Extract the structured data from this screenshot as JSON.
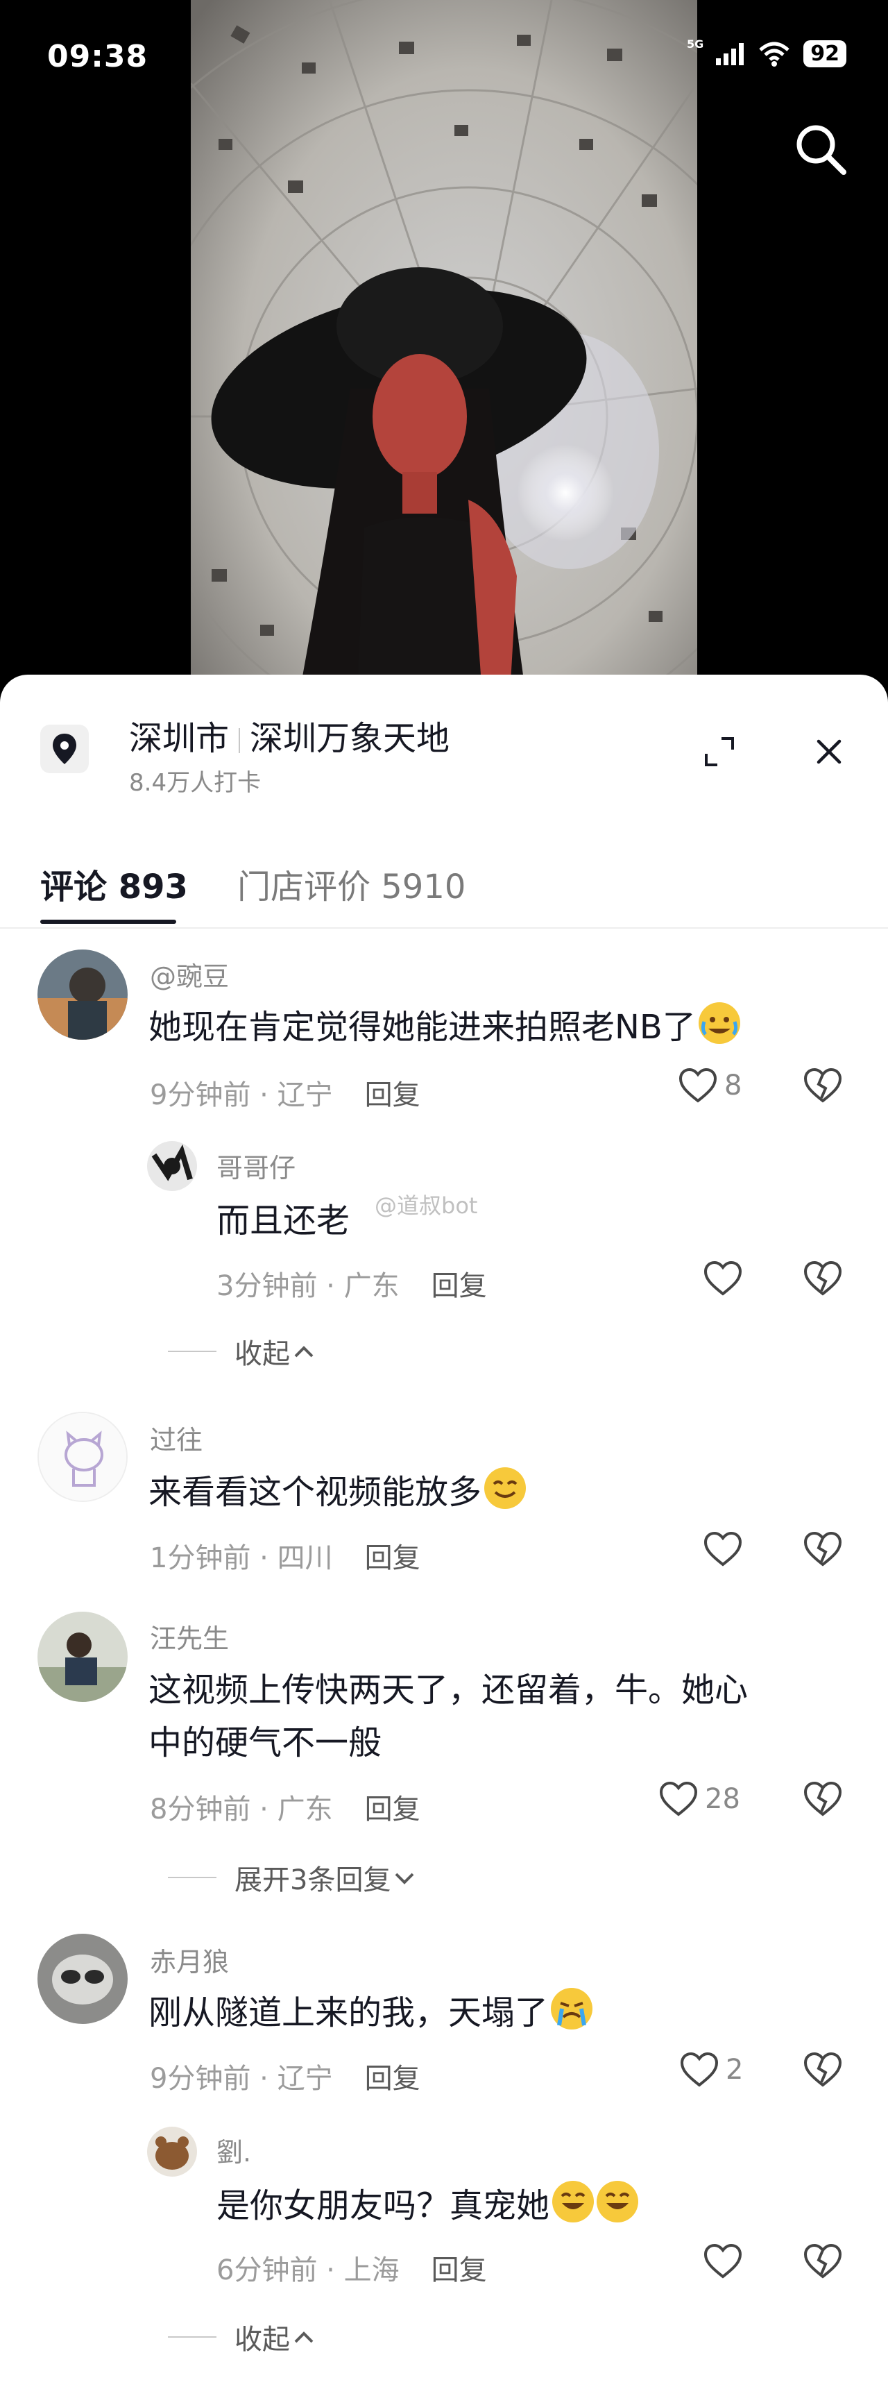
{
  "status_bar": {
    "time": "09:38",
    "signal": "5G",
    "battery": "92"
  },
  "location": {
    "title": "深圳市",
    "place": "深圳万象天地",
    "checkins": "8.4万人打卡"
  },
  "tabs": [
    {
      "label": "评论 893"
    },
    {
      "label": "门店评价 5910"
    }
  ],
  "watermark": "@道叔bot",
  "comments": [
    {
      "user": "@豌豆",
      "text": "她现在肯定觉得她能进来拍照老NB了",
      "time": "9分钟前 · 辽宁",
      "reply": "回复",
      "likes": "8",
      "emoji": "crying-laugh"
    },
    {
      "user": "哥哥仔",
      "text": "而且还老",
      "time": "3分钟前 · 广东",
      "reply": "回复",
      "likes": ""
    },
    {
      "user": "过往",
      "text": "来看看这个视频能放多",
      "time": "1分钟前 · 四川",
      "reply": "回复",
      "likes": "",
      "emoji": "smile"
    },
    {
      "user": "汪先生",
      "text_line1": "这视频上传快两天了，还留着，牛。她心",
      "text_line2": "中的硬气不一般",
      "time": "8分钟前 · 广东",
      "reply": "回复",
      "likes": "28"
    },
    {
      "user": "赤月狼",
      "text": "刚从隧道上来的我，天塌了",
      "time": "9分钟前 · 辽宁",
      "reply": "回复",
      "likes": "2",
      "emoji": "crying"
    },
    {
      "user": "劉.",
      "text": "是你女朋友吗？真宠她",
      "time": "6分钟前 · 上海",
      "reply": "回复",
      "likes": "",
      "emoji": "happy"
    }
  ],
  "fold_labels": {
    "collapse": "收起",
    "expand": "展开3条回复"
  },
  "colors": {
    "text": "#161823",
    "muted": "#8a8a8a",
    "sheet": "#ffffff"
  }
}
